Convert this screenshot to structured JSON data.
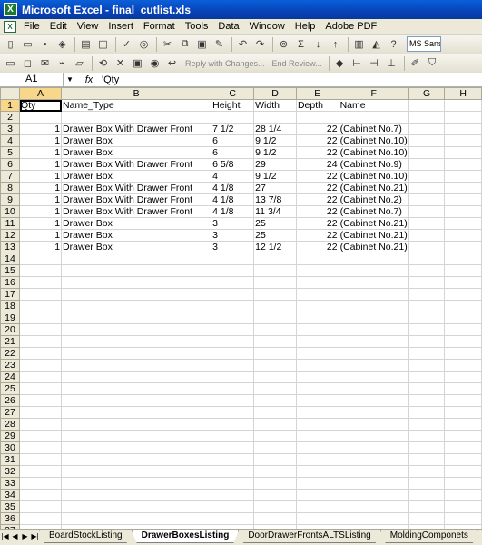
{
  "window": {
    "title": "Microsoft Excel - final_cutlist.xls",
    "icon": "excel-app-icon"
  },
  "menu": [
    "File",
    "Edit",
    "View",
    "Insert",
    "Format",
    "Tools",
    "Data",
    "Window",
    "Help",
    "Adobe PDF"
  ],
  "toolbar": {
    "font_name": "MS Sans",
    "review_reply": "Reply with Changes...",
    "review_end": "End Review..."
  },
  "formula_bar": {
    "cell_ref": "A1",
    "fx": "fx",
    "content": "'Qty"
  },
  "columns": [
    "A",
    "B",
    "C",
    "D",
    "E",
    "F",
    "G",
    "H"
  ],
  "header_row": [
    "Qty",
    "Name_Type",
    "Height",
    "Width",
    "Depth",
    "Name",
    "",
    ""
  ],
  "rows": [
    [
      "",
      "",
      "",
      "",
      "",
      "",
      "",
      ""
    ],
    [
      "1",
      "Drawer Box With Drawer Front",
      "7  1/2",
      "28  1/4",
      "22",
      "(Cabinet No.7)",
      "",
      ""
    ],
    [
      "1",
      "Drawer Box",
      "6",
      "9  1/2",
      "22",
      "(Cabinet No.10)",
      "",
      ""
    ],
    [
      "1",
      "Drawer Box",
      "6",
      "9  1/2",
      "22",
      "(Cabinet No.10)",
      "",
      ""
    ],
    [
      "1",
      "Drawer Box With Drawer Front",
      "6  5/8",
      "29",
      "24",
      "(Cabinet No.9)",
      "",
      ""
    ],
    [
      "1",
      "Drawer Box",
      "4",
      "9  1/2",
      "22",
      "(Cabinet No.10)",
      "",
      ""
    ],
    [
      "1",
      "Drawer Box With Drawer Front",
      "4  1/8",
      "27",
      "22",
      "(Cabinet No.21)",
      "",
      ""
    ],
    [
      "1",
      "Drawer Box With Drawer Front",
      "4  1/8",
      "13  7/8",
      "22",
      "(Cabinet No.2)",
      "",
      ""
    ],
    [
      "1",
      "Drawer Box With Drawer Front",
      "4  1/8",
      "11  3/4",
      "22",
      "(Cabinet No.7)",
      "",
      ""
    ],
    [
      "1",
      "Drawer Box",
      "3",
      "25",
      "22",
      "(Cabinet No.21)",
      "",
      ""
    ],
    [
      "1",
      "Drawer Box",
      "3",
      "25",
      "22",
      "(Cabinet No.21)",
      "",
      ""
    ],
    [
      "1",
      "Drawer Box",
      "3",
      "12  1/2",
      "22",
      "(Cabinet No.21)",
      "",
      ""
    ]
  ],
  "row_count": 37,
  "sheets": [
    "BoardStockListing",
    "DrawerBoxesListing",
    "DoorDrawerFrontsALTSListing",
    "MoldingComponets"
  ],
  "active_sheet": "DrawerBoxesListing",
  "colors": {
    "title_bar": "#0a5fd8",
    "header_bg": "#ece9d8",
    "active_header": "#f8d68a"
  }
}
